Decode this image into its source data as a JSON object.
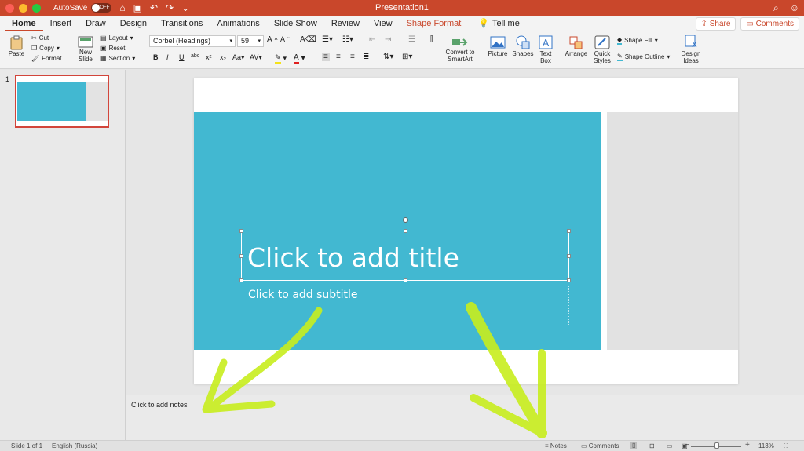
{
  "window": {
    "autosave_label": "AutoSave",
    "autosave_state": "OFF",
    "title": "Presentation1"
  },
  "tabs": [
    {
      "label": "Home",
      "active": true
    },
    {
      "label": "Insert"
    },
    {
      "label": "Draw"
    },
    {
      "label": "Design"
    },
    {
      "label": "Transitions"
    },
    {
      "label": "Animations"
    },
    {
      "label": "Slide Show"
    },
    {
      "label": "Review"
    },
    {
      "label": "View"
    },
    {
      "label": "Shape Format"
    }
  ],
  "tell_me": "Tell me",
  "share_label": "Share",
  "comments_label": "Comments",
  "ribbon": {
    "paste": "Paste",
    "cut": "Cut",
    "copy": "Copy",
    "format": "Format",
    "new_slide_1": "New",
    "new_slide_2": "Slide",
    "layout": "Layout",
    "reset": "Reset",
    "section": "Section",
    "font_name": "Corbel (Headings)",
    "font_size": "59",
    "bold": "B",
    "italic": "I",
    "underline": "U",
    "strike": "abc",
    "superscript": "x²",
    "subscript": "x₂",
    "convert_1": "Convert to",
    "convert_2": "SmartArt",
    "picture": "Picture",
    "shapes": "Shapes",
    "textbox_1": "Text",
    "textbox_2": "Box",
    "arrange": "Arrange",
    "quick_styles_1": "Quick",
    "quick_styles_2": "Styles",
    "shape_fill": "Shape Fill",
    "shape_outline": "Shape Outline",
    "design_ideas_1": "Design",
    "design_ideas_2": "Ideas"
  },
  "thumbnail": {
    "number": "1"
  },
  "slide": {
    "title_placeholder": "Click to add title",
    "subtitle_placeholder": "Click to add subtitle"
  },
  "notes_placeholder": "Click to add notes",
  "status": {
    "slide_count": "Slide 1 of 1",
    "language": "English (Russia)",
    "notes": "Notes",
    "comments": "Comments",
    "zoom": "113%"
  },
  "colors": {
    "accent": "#c9472b",
    "slide_blue": "#42b8d1",
    "annotation_green": "#c8ee1e"
  }
}
